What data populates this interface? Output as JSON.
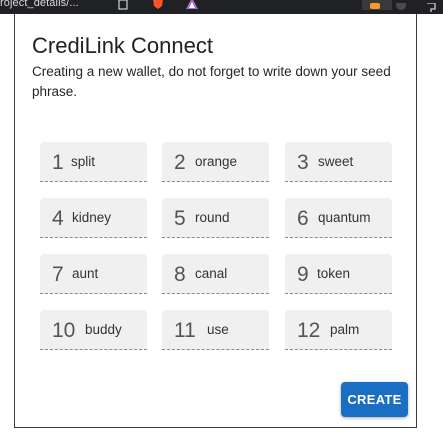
{
  "browser": {
    "tab_title": "roject_details/..."
  },
  "dialog": {
    "title": "CrediLink Connect",
    "subtitle": "Creating a new wallet, do not forget to write down your seed phrase.",
    "create_label": "CREATE"
  },
  "seed_words": [
    {
      "num": "1",
      "word": "split"
    },
    {
      "num": "2",
      "word": "orange"
    },
    {
      "num": "3",
      "word": "sweet"
    },
    {
      "num": "4",
      "word": "kidney"
    },
    {
      "num": "5",
      "word": "round"
    },
    {
      "num": "6",
      "word": "quantum"
    },
    {
      "num": "7",
      "word": "aunt"
    },
    {
      "num": "8",
      "word": "canal"
    },
    {
      "num": "9",
      "word": "token"
    },
    {
      "num": "10",
      "word": "buddy"
    },
    {
      "num": "11",
      "word": "use"
    },
    {
      "num": "12",
      "word": "palm"
    }
  ],
  "colors": {
    "accent": "#1b6fc2",
    "field_bg": "#f0f0f0",
    "browser_bar": "#202124"
  }
}
